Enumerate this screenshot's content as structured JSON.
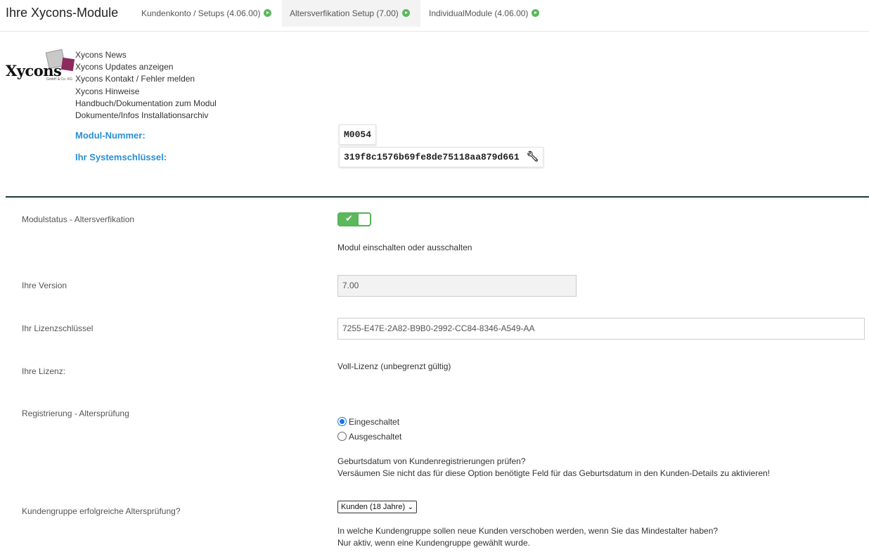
{
  "header": {
    "title": "Ihre Xycons-Module",
    "tabs": [
      {
        "label": "Kundenkonto / Setups (4.06.00)"
      },
      {
        "label": "Altersverfikation Setup (7.00)"
      },
      {
        "label": "IndividualModule (4.06.00)"
      }
    ]
  },
  "logo": {
    "text": "Xycons",
    "sub": "GmbH & Co. KG"
  },
  "links": [
    "Xycons News",
    "Xycons Updates anzeigen",
    "Xycons Kontakt / Fehler melden",
    "Xycons Hinweise",
    "Handbuch/Dokumentation zum Modul",
    "Dokumente/Infos Installationsarchiv"
  ],
  "meta": {
    "modul_nummer_label": "Modul-Nummer:",
    "modul_nummer": "M0054",
    "systemschluessel_label": "Ihr Systemschlüssel:",
    "systemschluessel": "319f8c1576b69fe8de75118aa879d661"
  },
  "form": {
    "modulstatus": {
      "label": "Modulstatus - Altersverfikation",
      "enabled": true,
      "hint": "Modul einschalten oder ausschalten"
    },
    "version": {
      "label": "Ihre Version",
      "value": "7.00"
    },
    "lizenzschluessel": {
      "label": "Ihr Lizenzschlüssel",
      "value": "7255-E47E-2A82-B9B0-2992-CC84-8346-A549-AA"
    },
    "lizenz": {
      "label": "Ihre Lizenz:",
      "value": "Voll-Lizenz (unbegrenzt gültig)"
    },
    "registrierung": {
      "label": "Registrierung - Altersprüfung",
      "options": [
        "Eingeschaltet",
        "Ausgeschaltet"
      ],
      "selected": "Eingeschaltet",
      "hint1": "Geburtsdatum von Kundenregistrierungen prüfen?",
      "hint2": "Versäumen Sie nicht das für diese Option benötigte Feld für das Geburtsdatum in den Kunden-Details zu aktivieren!"
    },
    "kundengruppe": {
      "label": "Kundengruppe erfolgreiche Altersprüfung?",
      "selected": "Kunden (18 Jahre)",
      "hint1": "In welche Kundengruppe sollen neue Kunden verschoben werden, wenn Sie das Mindestalter haben?",
      "hint2": "Nur aktiv, wenn eine Kundengruppe gewählt wurde."
    }
  }
}
